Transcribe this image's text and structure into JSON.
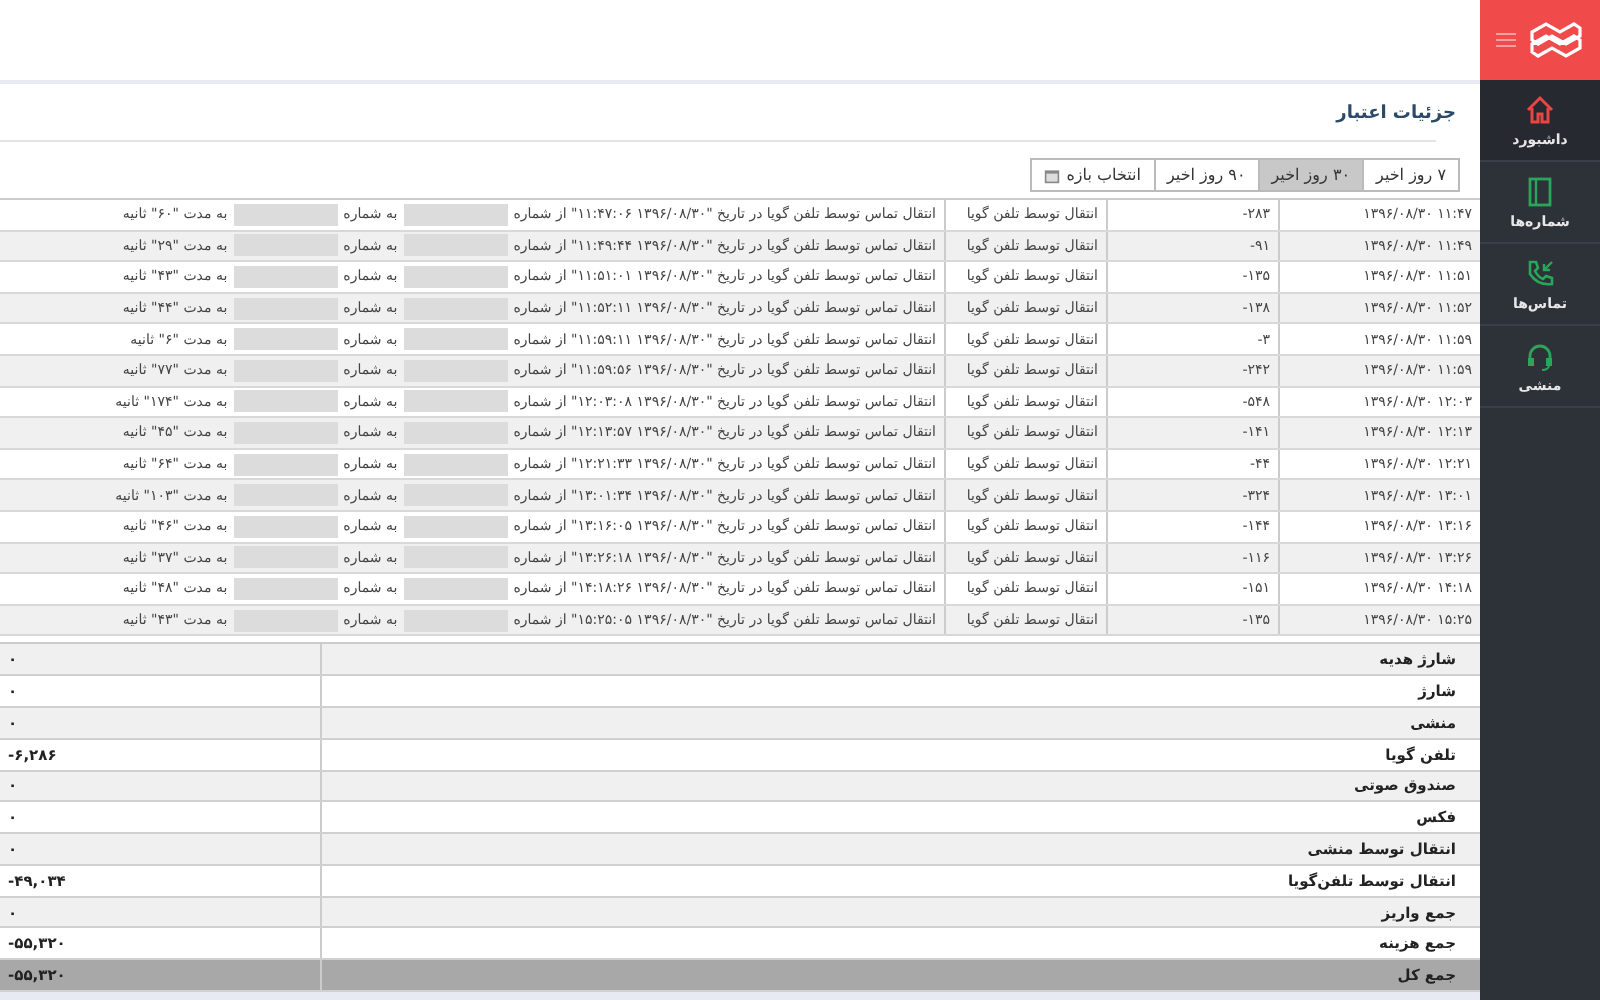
{
  "sidebar": {
    "items": [
      {
        "label": "داشبورد",
        "selected": true
      },
      {
        "label": "شماره‌ها",
        "selected": false
      },
      {
        "label": "تماس‌ها",
        "selected": false
      },
      {
        "label": "منشی",
        "selected": false
      }
    ]
  },
  "page": {
    "title": "جزئیات اعتبار"
  },
  "range_tabs": [
    {
      "label": "۷ روز اخیر",
      "kind": "preset",
      "selected": false
    },
    {
      "label": "۳۰ روز اخیر",
      "kind": "preset",
      "selected": true
    },
    {
      "label": "۹۰ روز اخیر",
      "kind": "preset",
      "selected": false
    },
    {
      "label": "انتخاب بازه",
      "kind": "custom",
      "selected": false
    }
  ],
  "transactions": [
    {
      "time": "۱۳۹۶/۰۸/۳۰ ۱۱:۴۷",
      "amount": "-۲۸۳",
      "type": "انتقال توسط تلفن گویا",
      "desc_start": "انتقال تماس توسط تلفن گویا در تاریخ \"۱۳۹۶/۰۸/۳۰ ۱۱:۴۷:۰۶\" از شماره",
      "desc_mid": "به شماره",
      "desc_end": "به مدت \"۶۰\" ثانیه"
    },
    {
      "time": "۱۳۹۶/۰۸/۳۰ ۱۱:۴۹",
      "amount": "-۹۱",
      "type": "انتقال توسط تلفن گویا",
      "desc_start": "انتقال تماس توسط تلفن گویا در تاریخ \"۱۳۹۶/۰۸/۳۰ ۱۱:۴۹:۴۴\" از شماره",
      "desc_mid": "به شماره",
      "desc_end": "به مدت \"۲۹\" ثانیه"
    },
    {
      "time": "۱۳۹۶/۰۸/۳۰ ۱۱:۵۱",
      "amount": "-۱۳۵",
      "type": "انتقال توسط تلفن گویا",
      "desc_start": "انتقال تماس توسط تلفن گویا در تاریخ \"۱۳۹۶/۰۸/۳۰ ۱۱:۵۱:۰۱\" از شماره",
      "desc_mid": "به شماره",
      "desc_end": "به مدت \"۴۳\" ثانیه"
    },
    {
      "time": "۱۳۹۶/۰۸/۳۰ ۱۱:۵۲",
      "amount": "-۱۳۸",
      "type": "انتقال توسط تلفن گویا",
      "desc_start": "انتقال تماس توسط تلفن گویا در تاریخ \"۱۳۹۶/۰۸/۳۰ ۱۱:۵۲:۱۱\" از شماره",
      "desc_mid": "به شماره",
      "desc_end": "به مدت \"۴۴\" ثانیه"
    },
    {
      "time": "۱۳۹۶/۰۸/۳۰ ۱۱:۵۹",
      "amount": "-۳",
      "type": "انتقال توسط تلفن گویا",
      "desc_start": "انتقال تماس توسط تلفن گویا در تاریخ \"۱۳۹۶/۰۸/۳۰ ۱۱:۵۹:۱۱\" از شماره",
      "desc_mid": "به شماره",
      "desc_end": "به مدت \"۶\" ثانیه"
    },
    {
      "time": "۱۳۹۶/۰۸/۳۰ ۱۱:۵۹",
      "amount": "-۲۴۲",
      "type": "انتقال توسط تلفن گویا",
      "desc_start": "انتقال تماس توسط تلفن گویا در تاریخ \"۱۳۹۶/۰۸/۳۰ ۱۱:۵۹:۵۶\" از شماره",
      "desc_mid": "به شماره",
      "desc_end": "به مدت \"۷۷\" ثانیه"
    },
    {
      "time": "۱۳۹۶/۰۸/۳۰ ۱۲:۰۳",
      "amount": "-۵۴۸",
      "type": "انتقال توسط تلفن گویا",
      "desc_start": "انتقال تماس توسط تلفن گویا در تاریخ \"۱۳۹۶/۰۸/۳۰ ۱۲:۰۳:۰۸\" از شماره",
      "desc_mid": "به شماره",
      "desc_end": "به مدت \"۱۷۴\" ثانیه"
    },
    {
      "time": "۱۳۹۶/۰۸/۳۰ ۱۲:۱۳",
      "amount": "-۱۴۱",
      "type": "انتقال توسط تلفن گویا",
      "desc_start": "انتقال تماس توسط تلفن گویا در تاریخ \"۱۳۹۶/۰۸/۳۰ ۱۲:۱۳:۵۷\" از شماره",
      "desc_mid": "به شماره",
      "desc_end": "به مدت \"۴۵\" ثانیه"
    },
    {
      "time": "۱۳۹۶/۰۸/۳۰ ۱۲:۲۱",
      "amount": "-۴۴",
      "type": "انتقال توسط تلفن گویا",
      "desc_start": "انتقال تماس توسط تلفن گویا در تاریخ \"۱۳۹۶/۰۸/۳۰ ۱۲:۲۱:۳۳\" از شماره",
      "desc_mid": "به شماره",
      "desc_end": "به مدت \"۶۴\" ثانیه"
    },
    {
      "time": "۱۳۹۶/۰۸/۳۰ ۱۳:۰۱",
      "amount": "-۳۲۴",
      "type": "انتقال توسط تلفن گویا",
      "desc_start": "انتقال تماس توسط تلفن گویا در تاریخ \"۱۳۹۶/۰۸/۳۰ ۱۳:۰۱:۳۴\" از شماره",
      "desc_mid": "به شماره",
      "desc_end": "به مدت \"۱۰۳\" ثانیه"
    },
    {
      "time": "۱۳۹۶/۰۸/۳۰ ۱۳:۱۶",
      "amount": "-۱۴۴",
      "type": "انتقال توسط تلفن گویا",
      "desc_start": "انتقال تماس توسط تلفن گویا در تاریخ \"۱۳۹۶/۰۸/۳۰ ۱۳:۱۶:۰۵\" از شماره",
      "desc_mid": "به شماره",
      "desc_end": "به مدت \"۴۶\" ثانیه"
    },
    {
      "time": "۱۳۹۶/۰۸/۳۰ ۱۳:۲۶",
      "amount": "-۱۱۶",
      "type": "انتقال توسط تلفن گویا",
      "desc_start": "انتقال تماس توسط تلفن گویا در تاریخ \"۱۳۹۶/۰۸/۳۰ ۱۳:۲۶:۱۸\" از شماره",
      "desc_mid": "به شماره",
      "desc_end": "به مدت \"۳۷\" ثانیه"
    },
    {
      "time": "۱۳۹۶/۰۸/۳۰ ۱۴:۱۸",
      "amount": "-۱۵۱",
      "type": "انتقال توسط تلفن گویا",
      "desc_start": "انتقال تماس توسط تلفن گویا در تاریخ \"۱۳۹۶/۰۸/۳۰ ۱۴:۱۸:۲۶\" از شماره",
      "desc_mid": "به شماره",
      "desc_end": "به مدت \"۴۸\" ثانیه"
    },
    {
      "time": "۱۳۹۶/۰۸/۳۰ ۱۵:۲۵",
      "amount": "-۱۳۵",
      "type": "انتقال توسط تلفن گویا",
      "desc_start": "انتقال تماس توسط تلفن گویا در تاریخ \"۱۳۹۶/۰۸/۳۰ ۱۵:۲۵:۰۵\" از شماره",
      "desc_mid": "به شماره",
      "desc_end": "به مدت \"۴۳\" ثانیه"
    }
  ],
  "summary": [
    {
      "label": "شارژ هدیه",
      "value": "۰",
      "kind": "item"
    },
    {
      "label": "شارژ",
      "value": "۰",
      "kind": "item"
    },
    {
      "label": "منشی",
      "value": "۰",
      "kind": "item"
    },
    {
      "label": "تلفن گویا",
      "value": "-۶,۲۸۶",
      "kind": "item"
    },
    {
      "label": "صندوق صوتی",
      "value": "۰",
      "kind": "item"
    },
    {
      "label": "فکس",
      "value": "۰",
      "kind": "item"
    },
    {
      "label": "انتقال توسط منشی",
      "value": "۰",
      "kind": "item"
    },
    {
      "label": "انتقال توسط تلفن‌گویا",
      "value": "-۴۹,۰۳۴",
      "kind": "item"
    },
    {
      "label": "جمع واریز",
      "value": "۰",
      "kind": "item"
    },
    {
      "label": "جمع هزینه",
      "value": "-۵۵,۳۲۰",
      "kind": "item"
    },
    {
      "label": "جمع کل",
      "value": "-۵۵,۳۲۰",
      "kind": "total"
    }
  ]
}
